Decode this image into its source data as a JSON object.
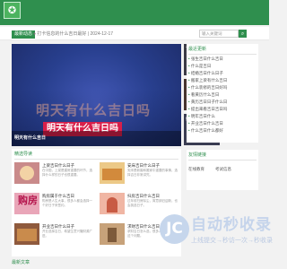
{
  "header": {
    "logo_glyph": "✪"
  },
  "topline": {
    "badge": "最新动态",
    "ticker": "● 打卡信息的什么吉日最好 | 2024-12-17",
    "search_placeholder": "输入关键词",
    "search_glyph": "⌕"
  },
  "hero": {
    "faint_text": "明天有什么吉日吗",
    "title": "明天有什么吉日吗",
    "caption": "明天有什么吉日"
  },
  "side_thumbs": [
    {
      "text": "下周搬家的吉日哪天"
    },
    {
      "text": "元旦有什么吉日"
    },
    {
      "text": "婚嫁吉日什么日子"
    }
  ],
  "recent": {
    "title": "最近更新",
    "items": [
      "张生吉日什么吉日",
      "什么是吉日",
      "结婚吉日什么日子",
      "搬家上梁有什么吉日",
      "什么装修的吉日好吗",
      "看黄历什么吉日",
      "黄历吉日日子什么日",
      "提出来看吉日吉日吗",
      "明年吉日什么",
      "开业吉日什么吉日",
      "什么吉日什么都好"
    ]
  },
  "friend_links": {
    "title": "友情链接",
    "items": [
      "在线教育",
      "考试信息"
    ]
  },
  "picks": {
    "title": "精选导读",
    "cards": [
      {
        "title": "上梁吉日什么日子",
        "text": "在中国，上梁是建房重要的环节，选择什么样的日子也很重要。"
      },
      {
        "title": "安床吉日什么日子",
        "text": "安床是新婚和搬家中重要的事情，选择吉日非常讲究。"
      },
      {
        "title": "购房属于什么吉日",
        "text": "购房是人生大事，很多人都会选择一个好日子来签约。"
      },
      {
        "title": "扫房吉日什么吉日",
        "text": "过年前扫房除尘，寓意辞旧迎新，也会挑选日子。"
      },
      {
        "title": "开业吉日什么日子",
        "text": "开业选择吉日，希望生意兴隆财源广进。"
      },
      {
        "title": "求财吉日什么吉日",
        "text": "求财吉日怎么选，很多人都非常关心这个问题。"
      }
    ]
  },
  "bottom": {
    "title": "最新文章"
  },
  "watermark": {
    "circle_glyph": "JC",
    "main": "自动秒收录",
    "sub": "上线提交→秒访一次→秒收录"
  }
}
